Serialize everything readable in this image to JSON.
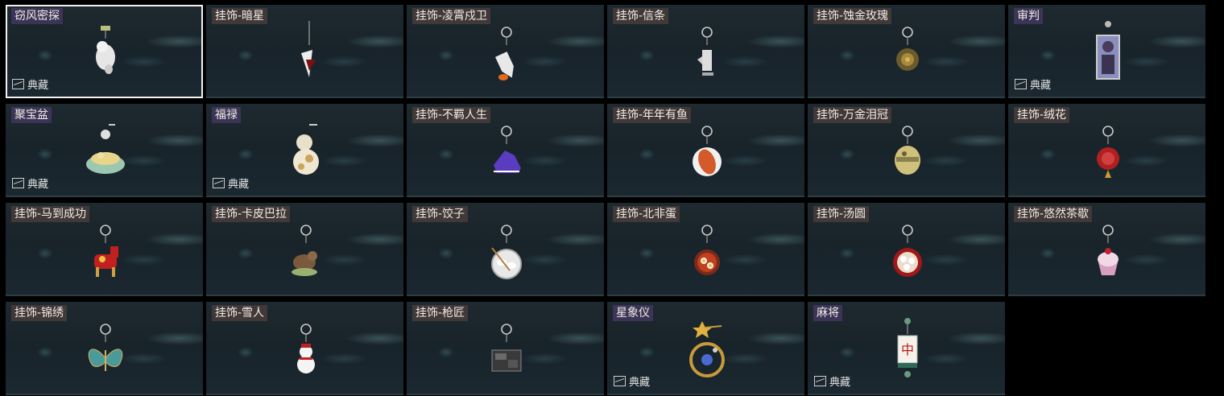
{
  "badge_label": "典藏",
  "items": [
    {
      "name": "窃风密探",
      "badge": true,
      "selected": true,
      "icon": "rabbit-charm-icon"
    },
    {
      "name": "挂饰-暗星",
      "badge": false,
      "icon": "dark-star-charm-icon"
    },
    {
      "name": "挂饰-凌霄戍卫",
      "badge": false,
      "icon": "rocket-charm-icon"
    },
    {
      "name": "挂饰-信条",
      "badge": false,
      "icon": "creed-charm-icon"
    },
    {
      "name": "挂饰-蚀金玫瑰",
      "badge": false,
      "icon": "gold-rose-charm-icon"
    },
    {
      "name": "审判",
      "badge": true,
      "icon": "judgment-card-charm-icon"
    },
    {
      "name": "聚宝盆",
      "badge": true,
      "icon": "treasure-bowl-charm-icon"
    },
    {
      "name": "福禄",
      "badge": true,
      "icon": "gourd-charm-icon"
    },
    {
      "name": "挂饰-不羁人生",
      "badge": false,
      "icon": "sneaker-charm-icon"
    },
    {
      "name": "挂饰-年年有鱼",
      "badge": false,
      "icon": "fish-plate-charm-icon"
    },
    {
      "name": "挂饰-万金泪冠",
      "badge": false,
      "icon": "gold-crown-charm-icon"
    },
    {
      "name": "挂饰-绒花",
      "badge": false,
      "icon": "velvet-flower-charm-icon"
    },
    {
      "name": "挂饰-马到成功",
      "badge": false,
      "icon": "horse-charm-icon"
    },
    {
      "name": "挂饰-卡皮巴拉",
      "badge": false,
      "icon": "capybara-charm-icon"
    },
    {
      "name": "挂饰-饺子",
      "badge": false,
      "icon": "dumpling-plate-charm-icon"
    },
    {
      "name": "挂饰-北非蛋",
      "badge": false,
      "icon": "shakshuka-pan-charm-icon"
    },
    {
      "name": "挂饰-汤圆",
      "badge": false,
      "icon": "tangyuan-bowl-charm-icon"
    },
    {
      "name": "挂饰-悠然茶歇",
      "badge": false,
      "icon": "cupcake-charm-icon"
    },
    {
      "name": "挂饰-锦绣",
      "badge": false,
      "icon": "butterfly-charm-icon"
    },
    {
      "name": "挂饰-雪人",
      "badge": false,
      "icon": "snowman-charm-icon"
    },
    {
      "name": "挂饰-枪匠",
      "badge": false,
      "icon": "gunsmith-box-charm-icon"
    },
    {
      "name": "星象仪",
      "badge": true,
      "icon": "orrery-charm-icon"
    },
    {
      "name": "麻将",
      "badge": true,
      "icon": "mahjong-tile-charm-icon"
    }
  ]
}
